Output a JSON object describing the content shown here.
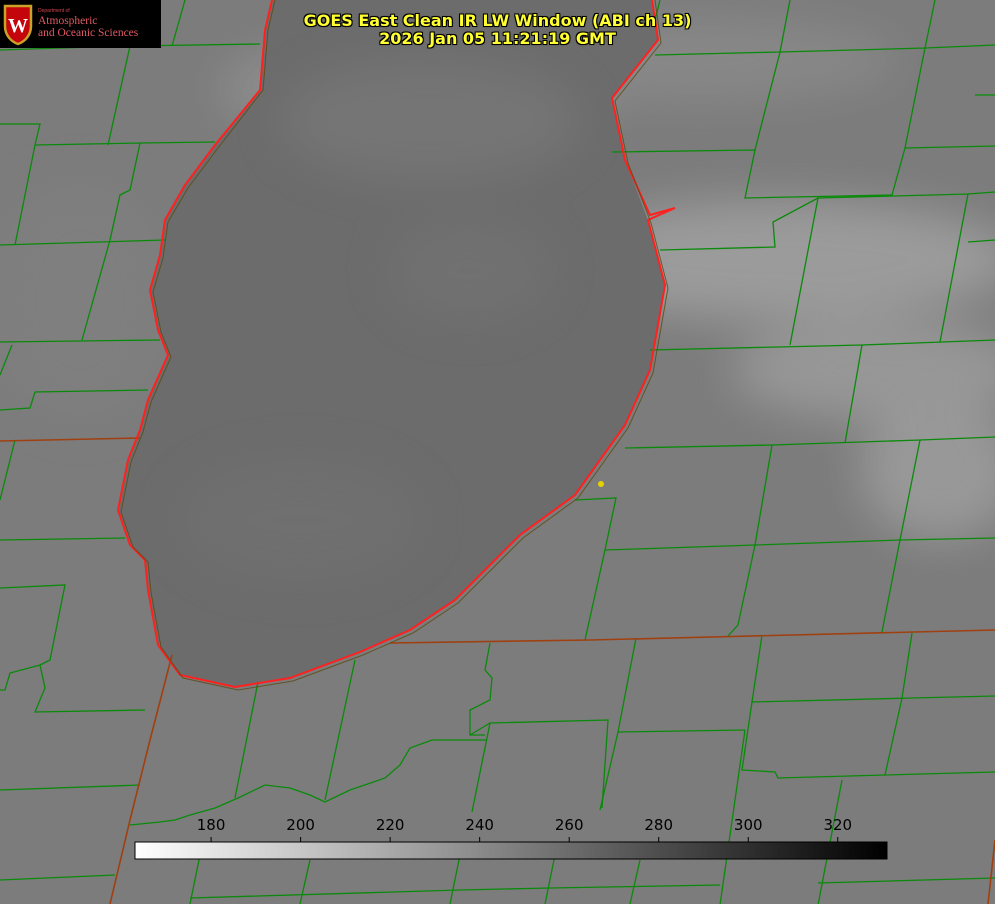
{
  "logo": {
    "department_line": "Department of",
    "line1": "Atmospheric",
    "line2": "and Oceanic Sciences",
    "emblem_icon": "uw-crest-icon",
    "emblem_letter": "W",
    "colors": {
      "crest_red": "#c5050c",
      "crest_gold": "#c9a227",
      "text_red": "#e05a63"
    }
  },
  "title": {
    "line1": "GOES East Clean IR LW Window (ABI ch 13)",
    "line2": "2026 Jan 05 11:21:19 GMT",
    "color": "#ffff33"
  },
  "map": {
    "colors": {
      "county_borders": "#0a8a0a",
      "state_borders": "#a04010",
      "lake_shoreline": "#ff2020",
      "marker": "#e6d200",
      "land_base": "#7c7c7c",
      "lake_base": "#6e6e6e",
      "cloud_tint": "#a2a2a2"
    },
    "features": [
      "lake",
      "county-borders",
      "state-borders",
      "shoreline",
      "location-marker"
    ]
  },
  "colorbar": {
    "min": 163,
    "max": 331,
    "ticks": [
      "180",
      "200",
      "220",
      "240",
      "260",
      "280",
      "300",
      "320"
    ],
    "color_low": "#ffffff",
    "color_high": "#000000"
  }
}
